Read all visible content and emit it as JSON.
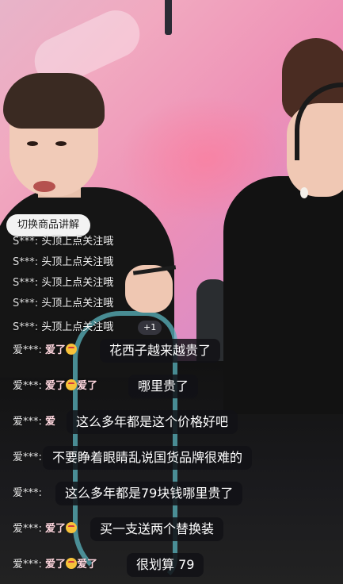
{
  "switch_button": {
    "label": "切换商品讲解"
  },
  "ticker": [
    {
      "user": "S***:",
      "text": "头顶上点关注哦"
    },
    {
      "user": "S***:",
      "text": "头顶上点关注哦"
    },
    {
      "user": "S***:",
      "text": "头顶上点关注哦"
    },
    {
      "user": "S***:",
      "text": "头顶上点关注哦"
    },
    {
      "user": "S***:",
      "text": "头顶上点关注哦"
    },
    {
      "user": "S***:",
      "text": "头顶上点关注哦"
    }
  ],
  "plus_badge": "+1",
  "comments": [
    {
      "user": "爱***:",
      "tag": "爱了",
      "message": "花西子越来越贵了"
    },
    {
      "user": "爱***:",
      "tag": "爱了",
      "tag2": "爱了",
      "message": "哪里贵了"
    },
    {
      "user": "爱***:",
      "tag": "爱",
      "message": "这么多年都是这个价格好吧"
    },
    {
      "user": "爱***:",
      "tag": "",
      "message": "不要睁着眼睛乱说国货品牌很难的"
    },
    {
      "user": "爱***:",
      "tag": "",
      "message": "这么多年都是79块钱哪里贵了"
    },
    {
      "user": "爱***:",
      "tag": "爱了",
      "message": "买一支送两个替换装"
    },
    {
      "user": "爱***:",
      "tag": "爱了",
      "tag2": "爱了",
      "message": "很划算 79"
    }
  ]
}
